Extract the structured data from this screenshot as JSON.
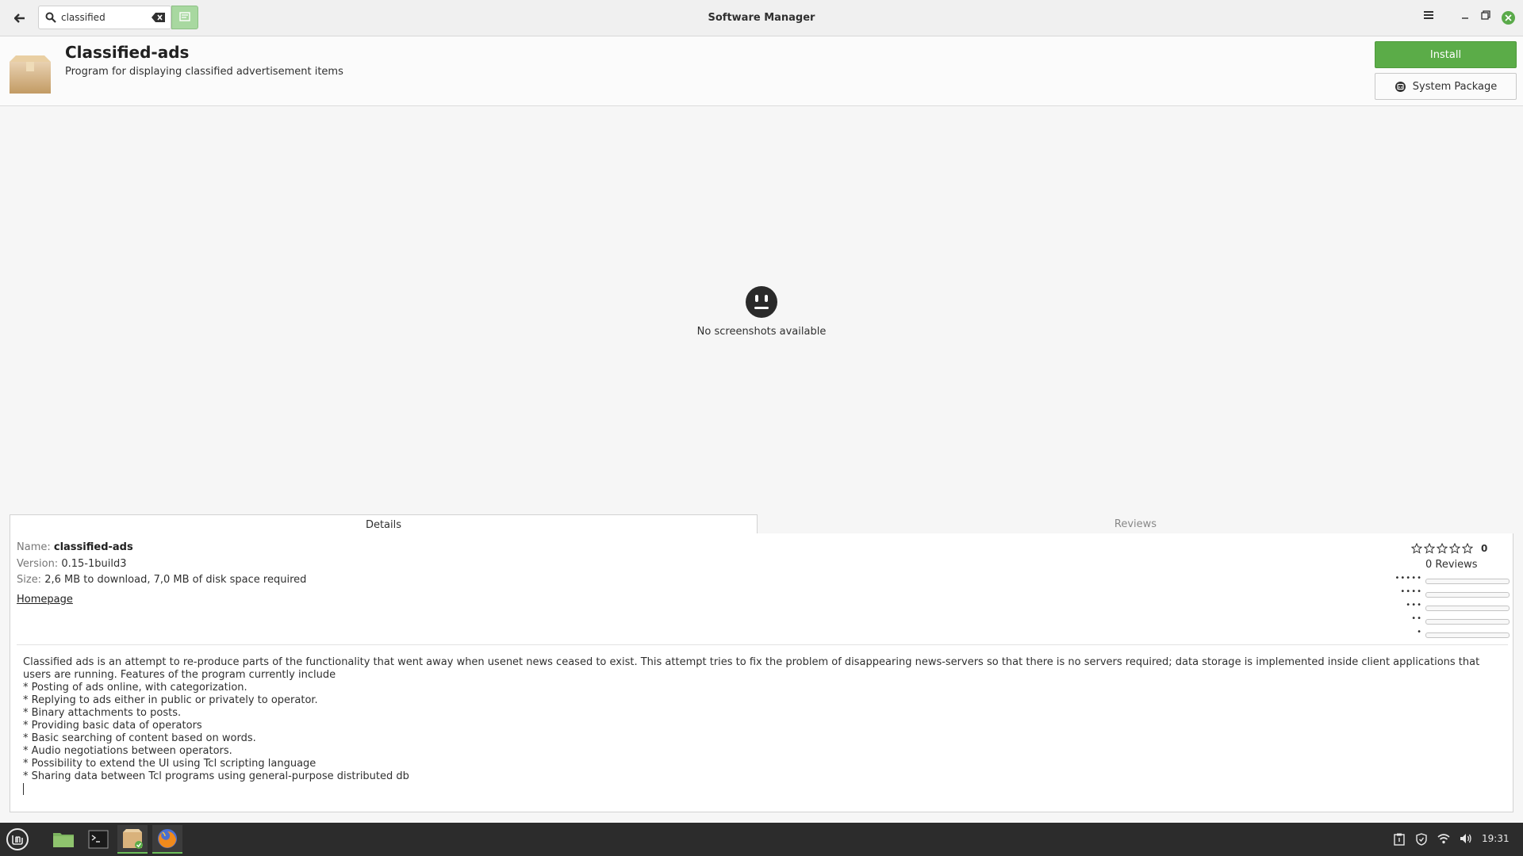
{
  "window": {
    "title": "Software Manager",
    "search_value": "classified"
  },
  "package": {
    "name": "Classified-ads",
    "summary": "Program for displaying classified advertisement items",
    "install_label": "Install",
    "source_label": "System Package"
  },
  "screenshots": {
    "empty_label": "No screenshots available"
  },
  "tabs": [
    {
      "label": "Details",
      "active": true
    },
    {
      "label": "Reviews",
      "active": false
    }
  ],
  "details": {
    "name_key": "Name:",
    "name_value": "classified-ads",
    "version_key": "Version:",
    "version_value": "0.15-1build3",
    "size_key": "Size:",
    "size_value": "2,6 MB to download, 7,0 MB of disk space required",
    "homepage_label": "Homepage"
  },
  "rating": {
    "score": "0",
    "reviews_label": "0 Reviews",
    "breakdown": [
      {
        "stars": 5,
        "fraction": 0
      },
      {
        "stars": 4,
        "fraction": 0
      },
      {
        "stars": 3,
        "fraction": 0
      },
      {
        "stars": 2,
        "fraction": 0
      },
      {
        "stars": 1,
        "fraction": 0
      }
    ]
  },
  "description": "Classified ads is an attempt to re-produce parts of the functionality that went away when usenet news ceased to exist. This attempt tries to fix the problem of disappearing news-servers so that there is no servers required; data storage is implemented inside client applications that users are running. Features of the program currently include\n* Posting of ads online, with categorization.\n* Replying to ads either in public or privately to operator.\n* Binary attachments to posts.\n* Providing basic data of operators\n* Basic searching of content based on words.\n* Audio negotiations between operators.\n* Possibility to extend the UI using Tcl scripting language\n* Sharing data between Tcl programs using general-purpose distributed db",
  "taskbar": {
    "clock": "19:31",
    "apps": [
      "menu-icon",
      "files-icon",
      "terminal-icon",
      "software-manager-icon",
      "firefox-icon"
    ]
  },
  "colors": {
    "accent": "#5bac48",
    "taskbar": "#2c2c2c"
  }
}
